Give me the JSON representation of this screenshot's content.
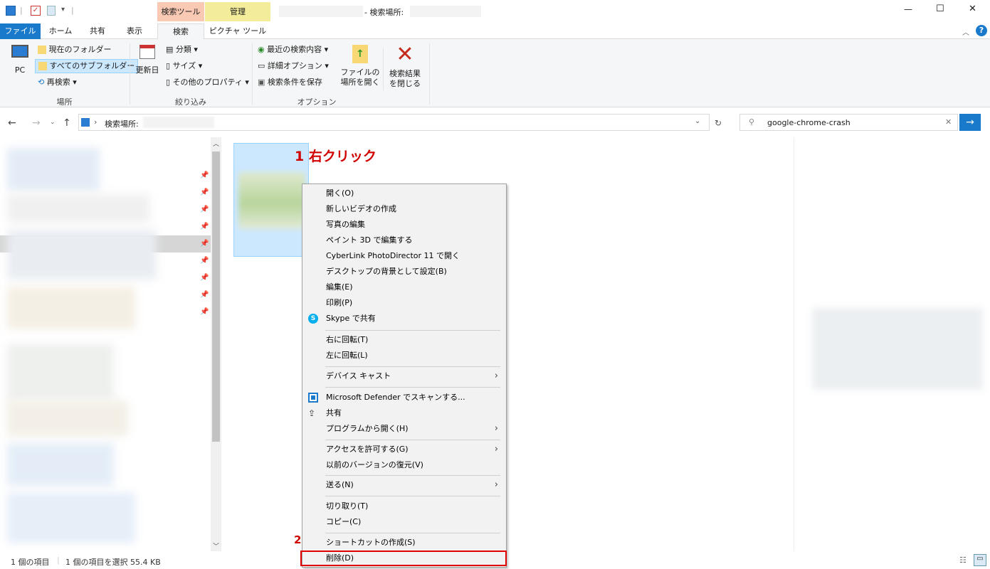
{
  "window": {
    "title": "- 検索場所:",
    "contextual_tabs": {
      "search_tools": "検索ツール",
      "manage": "管理"
    },
    "controls": {
      "minimize": "—",
      "maximize": "☐",
      "close": "✕"
    }
  },
  "tabs": [
    "ファイル",
    "ホーム",
    "共有",
    "表示",
    "検索",
    "ピクチャ ツール"
  ],
  "ribbon": {
    "location": {
      "pc": "PC",
      "current_folder": "現在のフォルダー",
      "all_subfolders": "すべてのサブフォルダー",
      "search_again": "再検索 ▾",
      "label": "場所"
    },
    "refine": {
      "date_modified": "更新日",
      "kind": "分類 ▾",
      "size": "サイズ ▾",
      "other_props": "その他のプロパティ ▾",
      "label": "絞り込み"
    },
    "options": {
      "recent_searches": "最近の検索内容 ▾",
      "advanced": "詳細オプション ▾",
      "save_search": "検索条件を保存",
      "open_location_1": "ファイルの",
      "open_location_2": "場所を開く",
      "close_1": "検索結果",
      "close_2": "を閉じる",
      "label": "オプション"
    }
  },
  "address": {
    "path": "検索場所:",
    "search_value": "google-chrome-crash"
  },
  "annotations": {
    "step1": "1 右クリック",
    "step2": "2"
  },
  "context_menu": {
    "open": "開く(O)",
    "new_video": "新しいビデオの作成",
    "edit_photos": "写真の編集",
    "paint3d": "ペイント 3D で編集する",
    "cyberlink": "CyberLink PhotoDirector 11 で開く",
    "set_background": "デスクトップの背景として設定(B)",
    "edit": "編集(E)",
    "print": "印刷(P)",
    "skype": "Skype で共有",
    "rotate_right": "右に回転(T)",
    "rotate_left": "左に回転(L)",
    "cast": "デバイス キャスト",
    "defender": "Microsoft Defender でスキャンする...",
    "share": "共有",
    "open_with": "プログラムから開く(H)",
    "give_access": "アクセスを許可する(G)",
    "restore": "以前のバージョンの復元(V)",
    "send_to": "送る(N)",
    "cut": "切り取り(T)",
    "copy": "コピー(C)",
    "create_shortcut": "ショートカットの作成(S)",
    "delete": "削除(D)"
  },
  "status": {
    "count": "1 個の項目",
    "selected": "1 個の項目を選択  55.4 KB"
  },
  "colors": {
    "accent": "#0063b1",
    "highlight": "#cce8ff",
    "annotation": "#e00000"
  }
}
